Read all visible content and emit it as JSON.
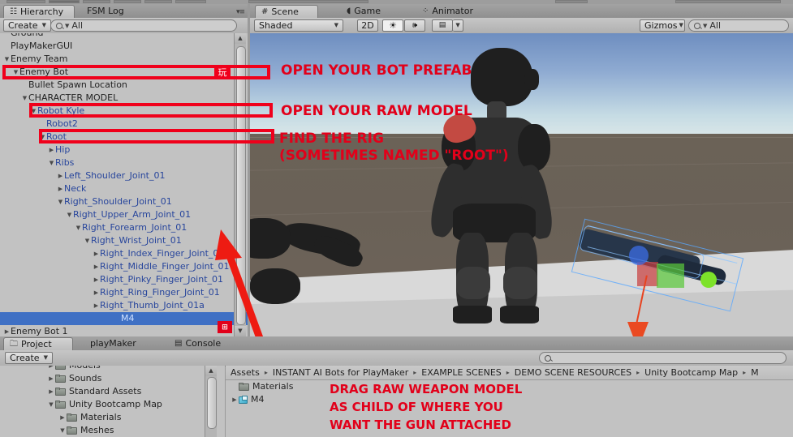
{
  "window": {
    "top_chrome_chips": 9
  },
  "hierarchy": {
    "tabs": [
      {
        "label": "Hierarchy",
        "icon": "hierarchy-list-icon",
        "active": true
      },
      {
        "label": "FSM Log",
        "icon": "",
        "active": false
      }
    ],
    "panel_menu_icon": "panel-options-icon",
    "create_button": "Create",
    "create_caret": "▾",
    "search_placeholder": "All",
    "search_icon": "search-icon",
    "search_caret": "▾",
    "items": [
      {
        "label": "Ground",
        "depth": 0,
        "twisty": "",
        "style": "normal",
        "clipped_top": true
      },
      {
        "label": "PlayMakerGUI",
        "depth": 0,
        "twisty": "",
        "style": "normal"
      },
      {
        "label": "Enemy Team",
        "depth": 0,
        "twisty": "▼",
        "style": "normal"
      },
      {
        "label": "Enemy Bot",
        "depth": 1,
        "twisty": "▼",
        "style": "normal"
      },
      {
        "label": "Bullet Spawn Location",
        "depth": 2,
        "twisty": "",
        "style": "normal"
      },
      {
        "label": "CHARACTER MODEL",
        "depth": 2,
        "twisty": "▼",
        "style": "normal"
      },
      {
        "label": "Robot Kyle",
        "depth": 3,
        "twisty": "▼",
        "style": "prefab"
      },
      {
        "label": "Robot2",
        "depth": 4,
        "twisty": "",
        "style": "prefab"
      },
      {
        "label": "Root",
        "depth": 4,
        "twisty": "▼",
        "style": "prefab"
      },
      {
        "label": "Hip",
        "depth": 5,
        "twisty": "▶",
        "style": "prefab"
      },
      {
        "label": "Ribs",
        "depth": 5,
        "twisty": "▼",
        "style": "prefab"
      },
      {
        "label": "Left_Shoulder_Joint_01",
        "depth": 6,
        "twisty": "▶",
        "style": "prefab"
      },
      {
        "label": "Neck",
        "depth": 6,
        "twisty": "▶",
        "style": "prefab"
      },
      {
        "label": "Right_Shoulder_Joint_01",
        "depth": 6,
        "twisty": "▼",
        "style": "prefab"
      },
      {
        "label": "Right_Upper_Arm_Joint_01",
        "depth": 7,
        "twisty": "▼",
        "style": "prefab"
      },
      {
        "label": "Right_Forearm_Joint_01",
        "depth": 8,
        "twisty": "▼",
        "style": "prefab"
      },
      {
        "label": "Right_Wrist_Joint_01",
        "depth": 9,
        "twisty": "▼",
        "style": "prefab"
      },
      {
        "label": "Right_Index_Finger_Joint_01",
        "depth": 10,
        "twisty": "▶",
        "style": "prefab"
      },
      {
        "label": "Right_Middle_Finger_Joint_01",
        "depth": 10,
        "twisty": "▶",
        "style": "prefab"
      },
      {
        "label": "Right_Pinky_Finger_Joint_01",
        "depth": 10,
        "twisty": "▶",
        "style": "prefab"
      },
      {
        "label": "Right_Ring_Finger_Joint_01",
        "depth": 10,
        "twisty": "▶",
        "style": "prefab"
      },
      {
        "label": "Right_Thumb_Joint_01a",
        "depth": 10,
        "twisty": "▶",
        "style": "prefab"
      },
      {
        "label": "M4",
        "depth": 10,
        "twisty": "",
        "style": "selected"
      },
      {
        "label": "Enemy Bot 1",
        "depth": 0,
        "twisty": "▶",
        "style": "normal"
      }
    ],
    "chinese_badge": "玩",
    "prefab_badge_icon": "prefab-badge-icon"
  },
  "scene": {
    "tabs": [
      {
        "label": "Scene",
        "icon": "grid-hash-icon",
        "active": true
      },
      {
        "label": "Game",
        "icon": "gamepad-icon",
        "active": false
      },
      {
        "label": "Animator",
        "icon": "animator-icon",
        "active": false
      }
    ],
    "draw_mode": "Shaded",
    "draw_mode_caret": "▾",
    "toggle_2d": "2D",
    "lighting_icon": "sun-icon",
    "audio_icon": "speaker-icon",
    "fx_icon": "image-fx-icon",
    "fx_caret": "▾",
    "gizmos_label": "Gizmos",
    "gizmos_caret": "▾",
    "gizmos_search_placeholder": "All",
    "gizmos_search_icon": "search-icon",
    "gizmos_search_caret": "▾"
  },
  "annotations": {
    "callout_1": "OPEN YOUR BOT PREFAB",
    "callout_2": "OPEN YOUR RAW MODEL",
    "callout_3_line1": "FIND THE RIG",
    "callout_3_line2": "(SOMETIMES NAMED \"ROOT\")",
    "callout_4_line1": "DRAG RAW WEAPON MODEL",
    "callout_4_line2": "AS CHILD OF WHERE YOU",
    "callout_4_line3": "WANT THE GUN ATTACHED",
    "color": "#e2001a"
  },
  "project": {
    "tabs": [
      {
        "label": "Project",
        "icon": "folder-icon",
        "active": true
      },
      {
        "label": "playMaker",
        "icon": "",
        "active": false
      },
      {
        "label": "Console",
        "icon": "console-icon",
        "active": false
      }
    ],
    "panel_menu_icon": "panel-options-icon",
    "create_button": "Create",
    "create_caret": "▾",
    "search_placeholder": "",
    "search_icon": "search-icon",
    "tree": [
      {
        "label": "Models",
        "depth": 1,
        "twisty": "▶",
        "clipped_top": true
      },
      {
        "label": "Sounds",
        "depth": 1,
        "twisty": "▶"
      },
      {
        "label": "Standard Assets",
        "depth": 1,
        "twisty": "▶"
      },
      {
        "label": "Unity Bootcamp Map",
        "depth": 1,
        "twisty": "▼"
      },
      {
        "label": "Materials",
        "depth": 2,
        "twisty": "▶"
      },
      {
        "label": "Meshes",
        "depth": 2,
        "twisty": "▼"
      }
    ],
    "breadcrumb": [
      "Assets",
      "INSTANT AI Bots for PlayMaker",
      "EXAMPLE SCENES",
      "DEMO SCENE RESOURCES",
      "Unity Bootcamp Map",
      "M"
    ],
    "breadcrumb_sep": "▸",
    "contents": [
      {
        "label": "Materials",
        "icon": "folder-icon",
        "twisty": ""
      },
      {
        "label": "M4",
        "icon": "prefab-cube-icon",
        "twisty": "▶"
      }
    ]
  }
}
